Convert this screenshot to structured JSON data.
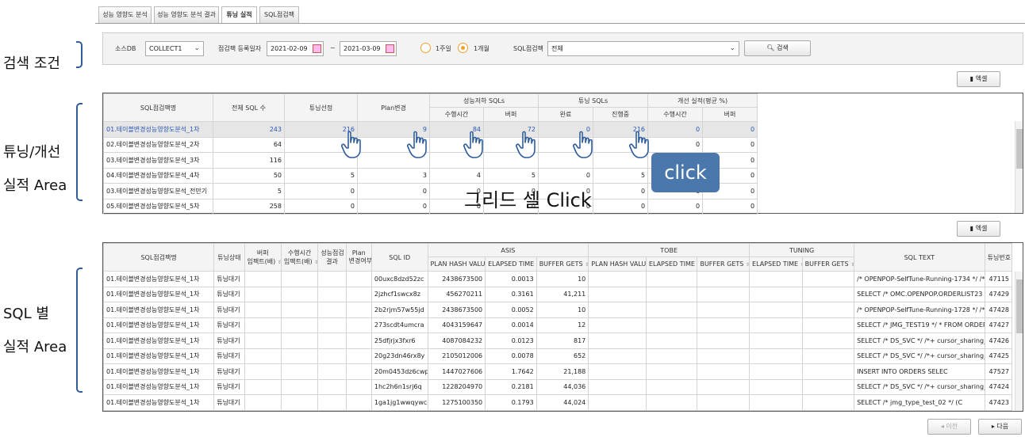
{
  "tabs": [
    "성능 영향도 분석",
    "성능 영향도 분석 결과",
    "튜닝 실적",
    "SQL점검팩"
  ],
  "annotations": {
    "search": "검색 조건",
    "tuning1": "튜닝/개선",
    "tuning2": "실적 Area",
    "sql1": "SQL 별",
    "sql2": "실적 Area",
    "click_badge": "click",
    "grid_click": "그리드 셀 Click"
  },
  "search": {
    "source_label": "소스DB",
    "source_value": "COLLECT1",
    "date_label": "점검팩 등록일자",
    "date_from": "2021-02-09",
    "tilde": "~",
    "date_to": "2021-03-09",
    "radio_week": "1주일",
    "radio_month": "1개월",
    "pack_label": "SQL점검팩",
    "pack_value": "전체",
    "search_button": "검색"
  },
  "excel_label": "엑셀",
  "grid1": {
    "headers": {
      "name": "SQL점검팩명",
      "total": "전체 SQL 수",
      "selected": "튜닝선정",
      "plan": "Plan변경",
      "degraded": "성능저하 SQLs",
      "tuning": "튜닝 SQLs",
      "improve": "개선 실적(평균 %)",
      "exec_time": "수행시간",
      "buffer": "버퍼",
      "done": "완료",
      "progress": "진행중",
      "exec_time2": "수행시간",
      "buffer2": "버퍼"
    },
    "rows": [
      [
        "01.테이블변경성능영향도분석_1차",
        "243",
        "216",
        "9",
        "84",
        "72",
        "0",
        "216",
        "0",
        "0"
      ],
      [
        "02.테이블변경성능영향도분석_2차",
        "64",
        "",
        "",
        "",
        "",
        "",
        "",
        "0",
        "0"
      ],
      [
        "03.테이블변경성능영향도분석_3차",
        "116",
        "",
        "",
        "",
        "",
        "",
        "",
        "0",
        "0"
      ],
      [
        "04.테이블변경성능영향도분석_4차",
        "50",
        "5",
        "3",
        "4",
        "5",
        "0",
        "5",
        "0",
        "0"
      ],
      [
        "03.테이블변경성능영향도분석_전만기",
        "5",
        "0",
        "0",
        "0",
        "0",
        "0",
        "0",
        "0",
        "0"
      ],
      [
        "05.테이블변경성능영향도분석_5차",
        "258",
        "0",
        "0",
        "0",
        "0",
        "0",
        "0",
        "0",
        "0"
      ]
    ]
  },
  "grid2": {
    "headers": {
      "name": "SQL점검팩명",
      "status": "튜닝상태",
      "buf1": "버퍼",
      "buf2": "임팩트(배)",
      "exec1": "수행시간",
      "exec2": "임팩트(배)",
      "check1": "성능점검",
      "check2": "결과",
      "plan1": "Plan",
      "plan2": "변경여부",
      "sqlid": "SQL ID",
      "asis": "ASIS",
      "tobe": "TOBE",
      "tuning": "TUNING",
      "phv": "PLAN HASH VALUE",
      "et": "ELAPSED TIME",
      "bg": "BUFFER GETS",
      "sqltext": "SQL TEXT",
      "tno": "튜닝번호"
    },
    "rows": [
      [
        "01.테이블변경성능영향도분석_1차",
        "튜닝대기",
        "00uxc8dzd52zc",
        "2438673500",
        "0.0013",
        "10",
        "/* OPENPOP-SelfTune-Running-1734 */ /*",
        "47115"
      ],
      [
        "01.테이블변경성능영향도분석_1차",
        "튜닝대기",
        "2jzhcf1swcx8z",
        "456270211",
        "0.3161",
        "41,211",
        "SELECT /* OMC.OPENPOP.ORDERLIST23 */ O",
        "47429"
      ],
      [
        "01.테이블변경성능영향도분석_1차",
        "튜닝대기",
        "2b2rjm57w55jd",
        "2438673500",
        "0.0052",
        "10",
        "/* OPENPOP-SelfTune-Running-1728 */ /*",
        "47428"
      ],
      [
        "01.테이블변경성능영향도분석_1차",
        "튜닝대기",
        "273scdt4umcra",
        "4043159647",
        "0.0014",
        "12",
        "SELECT /* JMG_TEST19 */ * FROM ORDERS WH",
        "47427"
      ],
      [
        "01.테이블변경성능영향도분석_1차",
        "튜닝대기",
        "25dfjrjx3fxr6",
        "4087084232",
        "0.0123",
        "817",
        "SELECT /* DS_SVC */ /*+ cursor_sharing_e",
        "47426"
      ],
      [
        "01.테이블변경성능영향도분석_1차",
        "튜닝대기",
        "20g23dn46rx8y",
        "2105012006",
        "0.0078",
        "652",
        "SELECT /* DS_SVC */ /*+ cursor_sharing_e",
        "47425"
      ],
      [
        "01.테이블변경성능영향도분석_1차",
        "튜닝대기",
        "20m0453dz6cwp",
        "1447027606",
        "1.7642",
        "21,188",
        "INSERT INTO ORDERS SELEC",
        "47527"
      ],
      [
        "01.테이블변경성능영향도분석_1차",
        "튜닝대기",
        "1hc2h6n1srj6q",
        "1228204970",
        "0.2181",
        "44,036",
        "SELECT /* DS_SVC */ /*+ cursor_sharing_e",
        "47424"
      ],
      [
        "01.테이블변경성능영향도분석_1차",
        "튜닝대기",
        "1ga1jg1wwqywc",
        "1275100350",
        "0.1793",
        "44,024",
        "SELECT /* jmg_type_test_02 */ (C",
        "47423"
      ]
    ]
  },
  "pager": {
    "prev": "이전",
    "next": "다음"
  }
}
